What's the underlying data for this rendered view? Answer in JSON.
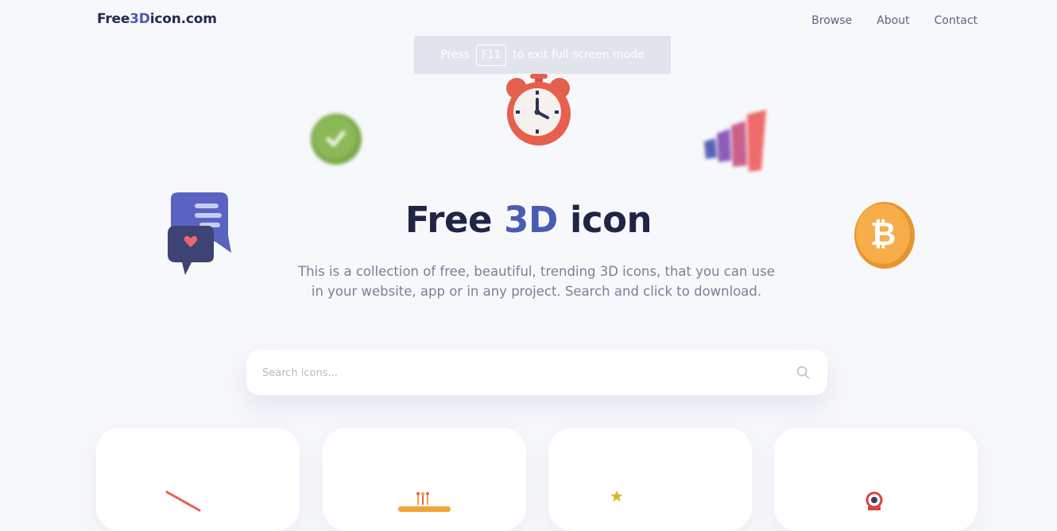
{
  "site": {
    "logo_prefix": "Free",
    "logo_accent": "3D",
    "logo_suffix": "icon.com"
  },
  "nav": {
    "browse": "Browse",
    "about": "About",
    "contact": "Contact"
  },
  "fullscreen_notice": {
    "before": "Press",
    "key": "F11",
    "after": "to exit full screen mode"
  },
  "hero": {
    "title_start": "Free",
    "title_accent": "3D",
    "title_end": "icon",
    "description": "This is a collection of free, beautiful, trending 3D icons, that you can use in your website, app or in any project. Search and click to download."
  },
  "search": {
    "placeholder": "Search icons..."
  },
  "colors": {
    "accent": "#4a5bb0",
    "heading": "#1f2544",
    "background": "#f7f8fc"
  },
  "decor_icons": [
    "alarm-clock-icon",
    "checkmark-circle-icon",
    "bar-chart-icon",
    "chat-bubbles-icon",
    "bitcoin-coin-icon"
  ],
  "cards": [
    {
      "icon": "rocket-icon"
    },
    {
      "icon": "birthday-cake-icon"
    },
    {
      "icon": "star-icon"
    },
    {
      "icon": "map-pin-icon"
    }
  ]
}
